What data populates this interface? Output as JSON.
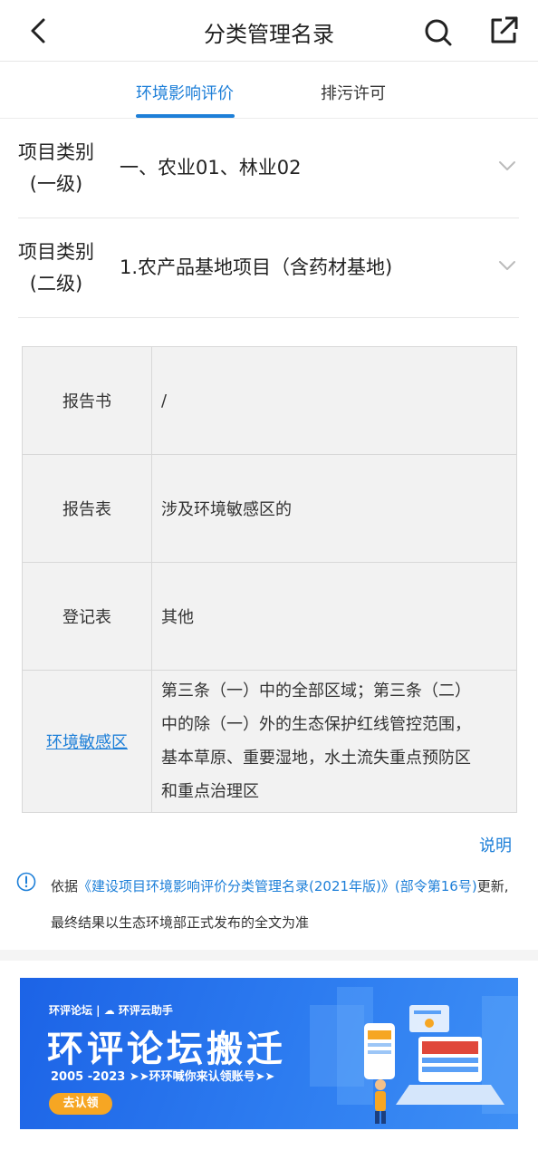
{
  "header": {
    "title": "分类管理名录"
  },
  "tabs": [
    {
      "label": "环境影响评价",
      "active": true
    },
    {
      "label": "排污许可",
      "active": false
    }
  ],
  "categories": [
    {
      "label_line1": "项目类别",
      "label_line2": "(一级)",
      "value": "一、农业01、林业02"
    },
    {
      "label_line1": "项目类别",
      "label_line2": "(二级)",
      "value": "1.农产品基地项目（含药材基地)"
    }
  ],
  "table": {
    "rows": [
      {
        "label": "报告书",
        "value": "/"
      },
      {
        "label": "报告表",
        "value": "涉及环境敏感区的"
      },
      {
        "label": "登记表",
        "value": "其他"
      },
      {
        "label": "环境敏感区",
        "value_lines": [
          "第三条（一）中的全部区域；第三条（二）",
          "中的除（一）外的生态保护红线管控范围，",
          "基本草原、重要湿地，水土流失重点预防区",
          "和重点治理区"
        ]
      }
    ]
  },
  "explain": "说明",
  "notice": {
    "prefix": "依据",
    "ref": "《建设项目环境影响评价分类管理名录(2021年版)》(部令第16号)",
    "suffix": "更新,最终结果以生态环境部正式发布的全文为准"
  },
  "banner": {
    "brand": "环评论坛 | ☁ 环评云助手",
    "headline": "环评论坛搬迁",
    "sub": "2005 -2023  ➤➤环环喊你来认领账号➤➤",
    "cta": "去认领"
  },
  "colors": {
    "accent": "#1d7fd8",
    "banner_bg": "#2d7cf0",
    "cta": "#f6a623"
  }
}
